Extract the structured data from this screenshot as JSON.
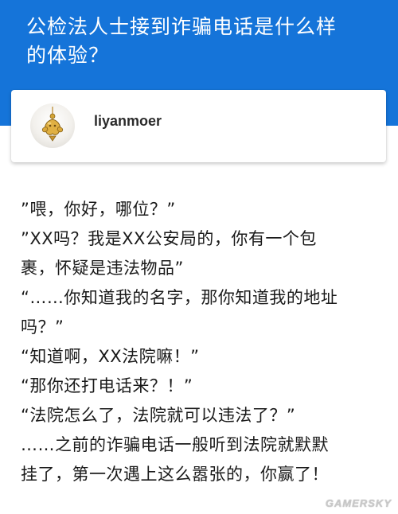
{
  "question": {
    "title_line1": "公检法人士接到诈骗电话是什么样",
    "title_line2": "的体验？"
  },
  "author": {
    "name": "liyanmoer",
    "avatar_icon": "gold-pendant-avatar-icon"
  },
  "answer": {
    "lines": [
      "”喂，你好，哪位？”",
      "”XX吗？我是XX公安局的，你有一个包",
      "裹，怀疑是违法物品”",
      "“……你知道我的名字，那你知道我的地址",
      "吗？”",
      "“知道啊，XX法院嘛！”",
      "“那你还打电话来？！”",
      "“法院怎么了，法院就可以违法了？”",
      "……之前的诈骗电话一般听到法院就默默",
      "挂了，第一次遇上这么嚣张的，你赢了！"
    ]
  },
  "watermark": "GAMERSKY",
  "colors": {
    "header_bg": "#1574d9",
    "title_text": "#ffffff",
    "body_text": "#1a1a1a"
  }
}
